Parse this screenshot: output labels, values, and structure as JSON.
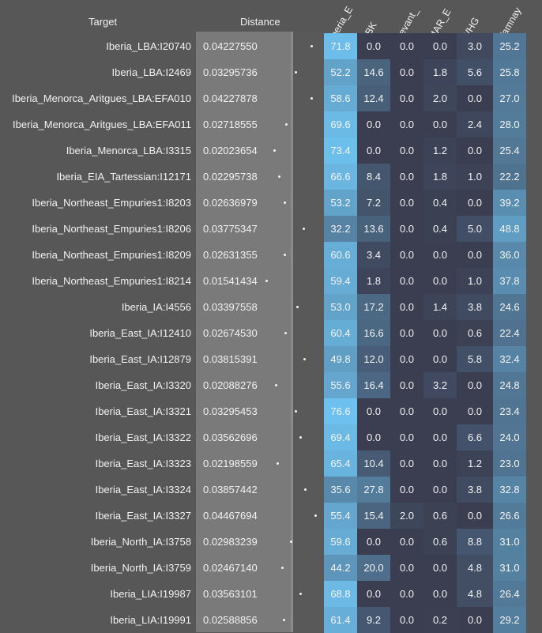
{
  "chart_data": {
    "type": "table",
    "columns": {
      "target": "Target",
      "distance": "Distance",
      "components": [
        "Iberia_E",
        "LBK",
        "Levant_",
        "MAR_E",
        "WHG",
        "Yamnay"
      ]
    },
    "rows": [
      {
        "target": "Iberia_LBA:I20740",
        "distance": "0.04227550",
        "values": [
          71.8,
          0.0,
          0.0,
          0.0,
          3.0,
          25.2
        ]
      },
      {
        "target": "Iberia_LBA:I2469",
        "distance": "0.03295736",
        "values": [
          52.2,
          14.6,
          0.0,
          1.8,
          5.6,
          25.8
        ]
      },
      {
        "target": "Iberia_Menorca_Aritgues_LBA:EFA010",
        "distance": "0.04227878",
        "values": [
          58.6,
          12.4,
          0.0,
          2.0,
          0.0,
          27.0
        ]
      },
      {
        "target": "Iberia_Menorca_Aritgues_LBA:EFA011",
        "distance": "0.02718555",
        "values": [
          69.6,
          0.0,
          0.0,
          0.0,
          2.4,
          28.0
        ]
      },
      {
        "target": "Iberia_Menorca_LBA:I3315",
        "distance": "0.02023654",
        "values": [
          73.4,
          0.0,
          0.0,
          1.2,
          0.0,
          25.4
        ]
      },
      {
        "target": "Iberia_EIA_Tartessian:I12171",
        "distance": "0.02295738",
        "values": [
          66.6,
          8.4,
          0.0,
          1.8,
          1.0,
          22.2
        ]
      },
      {
        "target": "Iberia_Northeast_Empuries1:I8203",
        "distance": "0.02636979",
        "values": [
          53.2,
          7.2,
          0.0,
          0.4,
          0.0,
          39.2
        ]
      },
      {
        "target": "Iberia_Northeast_Empuries1:I8206",
        "distance": "0.03775347",
        "values": [
          32.2,
          13.6,
          0.0,
          0.4,
          5.0,
          48.8
        ]
      },
      {
        "target": "Iberia_Northeast_Empuries1:I8209",
        "distance": "0.02631355",
        "values": [
          60.6,
          3.4,
          0.0,
          0.0,
          0.0,
          36.0
        ]
      },
      {
        "target": "Iberia_Northeast_Empuries1:I8214",
        "distance": "0.01541434",
        "values": [
          59.4,
          1.8,
          0.0,
          0.0,
          1.0,
          37.8
        ]
      },
      {
        "target": "Iberia_IA:I4556",
        "distance": "0.03397558",
        "values": [
          53.0,
          17.2,
          0.0,
          1.4,
          3.8,
          24.6
        ]
      },
      {
        "target": "Iberia_East_IA:I12410",
        "distance": "0.02674530",
        "values": [
          60.4,
          16.6,
          0.0,
          0.0,
          0.6,
          22.4
        ]
      },
      {
        "target": "Iberia_East_IA:I12879",
        "distance": "0.03815391",
        "values": [
          49.8,
          12.0,
          0.0,
          0.0,
          5.8,
          32.4
        ]
      },
      {
        "target": "Iberia_East_IA:I3320",
        "distance": "0.02088276",
        "values": [
          55.6,
          16.4,
          0.0,
          3.2,
          0.0,
          24.8
        ]
      },
      {
        "target": "Iberia_East_IA:I3321",
        "distance": "0.03295453",
        "values": [
          76.6,
          0.0,
          0.0,
          0.0,
          0.0,
          23.4
        ]
      },
      {
        "target": "Iberia_East_IA:I3322",
        "distance": "0.03562696",
        "values": [
          69.4,
          0.0,
          0.0,
          0.0,
          6.6,
          24.0
        ]
      },
      {
        "target": "Iberia_East_IA:I3323",
        "distance": "0.02198559",
        "values": [
          65.4,
          10.4,
          0.0,
          0.0,
          1.2,
          23.0
        ]
      },
      {
        "target": "Iberia_East_IA:I3324",
        "distance": "0.03857442",
        "values": [
          35.6,
          27.8,
          0.0,
          0.0,
          3.8,
          32.8
        ]
      },
      {
        "target": "Iberia_East_IA:I3327",
        "distance": "0.04467694",
        "values": [
          55.4,
          15.4,
          2.0,
          0.6,
          0.0,
          26.6
        ]
      },
      {
        "target": "Iberia_North_IA:I3758",
        "distance": "0.02983239",
        "values": [
          59.6,
          0.0,
          0.0,
          0.6,
          8.8,
          31.0
        ]
      },
      {
        "target": "Iberia_North_IA:I3759",
        "distance": "0.02467140",
        "values": [
          44.2,
          20.0,
          0.0,
          0.0,
          4.8,
          31.0
        ]
      },
      {
        "target": "Iberia_LIA:I19987",
        "distance": "0.03563101",
        "values": [
          68.8,
          0.0,
          0.0,
          0.0,
          4.8,
          26.4
        ]
      },
      {
        "target": "Iberia_LIA:I19991",
        "distance": "0.02588856",
        "values": [
          61.4,
          9.2,
          0.0,
          0.2,
          0.0,
          29.2
        ]
      }
    ],
    "colors": {
      "background": "#575757",
      "distance_panel": "#7a7a7a",
      "heat_low": "#3b3d50",
      "heat_high": "#6ec1ee"
    }
  }
}
